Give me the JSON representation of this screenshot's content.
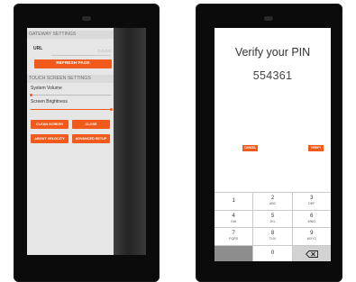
{
  "gateway": {
    "section_title": "GATEWAY SETTINGS",
    "url_label": "URL",
    "url_value": "0.0.0.0",
    "refresh_button": "REFRESH PAGE"
  },
  "touch": {
    "section_title": "TOUCH SCREEN SETTINGS",
    "volume_label": "System Volume",
    "volume_level": 0,
    "brightness_label": "Screen Brightness",
    "brightness_level": 1
  },
  "actions": {
    "clean_screen": "CLEAN SCREEN",
    "close": "CLOSE",
    "about": "ABOUT VELOCITY",
    "advanced": "ADVANCED SETUP"
  },
  "pin": {
    "title": "Verify your PIN",
    "value": "554361",
    "cancel": "CANCEL",
    "verify": "VERIFY"
  },
  "keypad": {
    "keys": [
      {
        "num": "1",
        "letters": ""
      },
      {
        "num": "2",
        "letters": "ABC"
      },
      {
        "num": "3",
        "letters": "DEF"
      },
      {
        "num": "4",
        "letters": "GHI"
      },
      {
        "num": "5",
        "letters": "JKL"
      },
      {
        "num": "6",
        "letters": "MNO"
      },
      {
        "num": "7",
        "letters": "PQRS"
      },
      {
        "num": "8",
        "letters": "TUV"
      },
      {
        "num": "9",
        "letters": "WXYZ"
      },
      {
        "num": "",
        "letters": ""
      },
      {
        "num": "0",
        "letters": ""
      },
      {
        "num": "",
        "letters": ""
      }
    ],
    "backspace_icon": "backspace-icon"
  },
  "colors": {
    "accent": "#f25a1c",
    "device": "#0b0b0b",
    "menu_bg": "#e6e6e6"
  }
}
